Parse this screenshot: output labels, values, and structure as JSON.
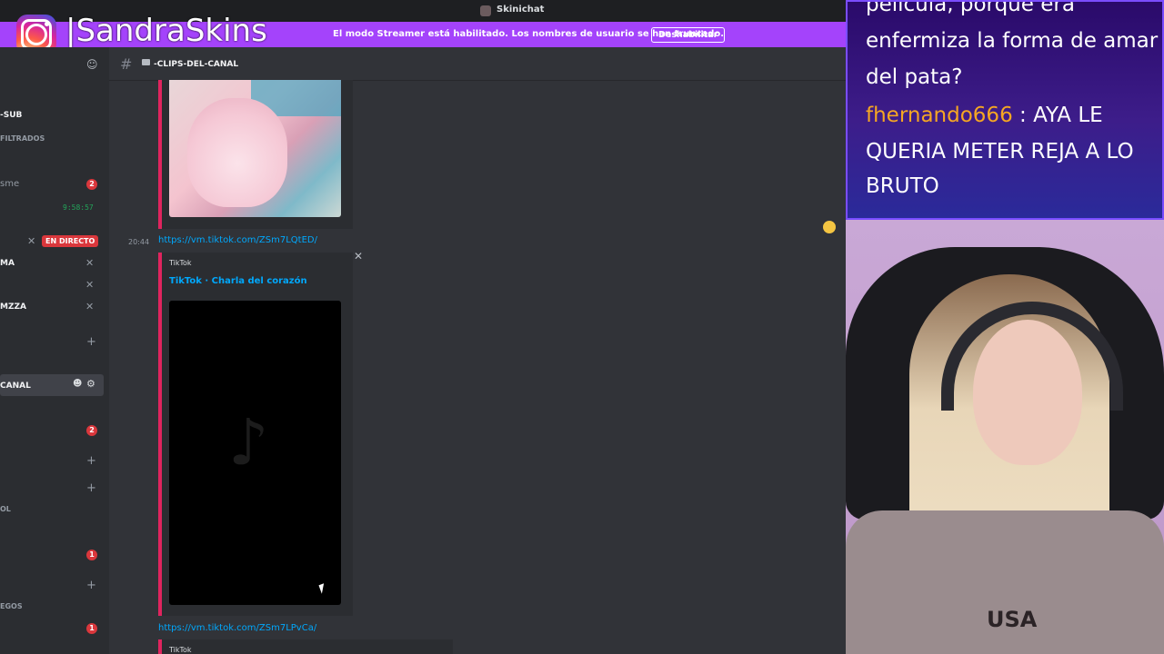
{
  "titlebar": {
    "app_name": "Skinichat"
  },
  "banner": {
    "message": "El modo Streamer está habilitado. Los nombres de usuario se han truncado.",
    "button": "Deshabilitar"
  },
  "overlay_brand": {
    "handle": "|SandraSkins"
  },
  "sidebar": {
    "items": [
      {
        "label": "-SUB"
      },
      {
        "label": "FILTRADOS"
      },
      {
        "label": "sme",
        "badge": "2"
      },
      {
        "label": "9:58:57"
      },
      {
        "label": "EN DIRECTO"
      },
      {
        "label": "MA"
      },
      {
        "label": "MZZA"
      },
      {
        "label": "CANAL"
      },
      {
        "label": "",
        "badge": "2"
      },
      {
        "label": "OL"
      },
      {
        "label": "",
        "badge": "1"
      },
      {
        "label": "EGOS",
        "badge": "1"
      }
    ]
  },
  "channel": {
    "name": "-CLIPS-DEL-CANAL"
  },
  "messages": [
    {
      "time": "20:44",
      "link": "https://vm.tiktok.com/ZSm7LQtED/",
      "embed_provider": "TikTok",
      "embed_title": "TikTok · Charla del corazón"
    },
    {
      "link": "https://vm.tiktok.com/ZSm7LPvCa/",
      "embed_provider": "TikTok"
    }
  ],
  "chat_overlay": {
    "line1": "película, porque era",
    "line2": "enfermiza la forma de amar",
    "line3": "del pata?",
    "user": "fhernando666",
    "msg_line1": " : AYA LE",
    "msg_line2": "QUERIA METER REJA A LO",
    "msg_line3": "BRUTO"
  },
  "webcam": {
    "shirt_text": "USA"
  }
}
